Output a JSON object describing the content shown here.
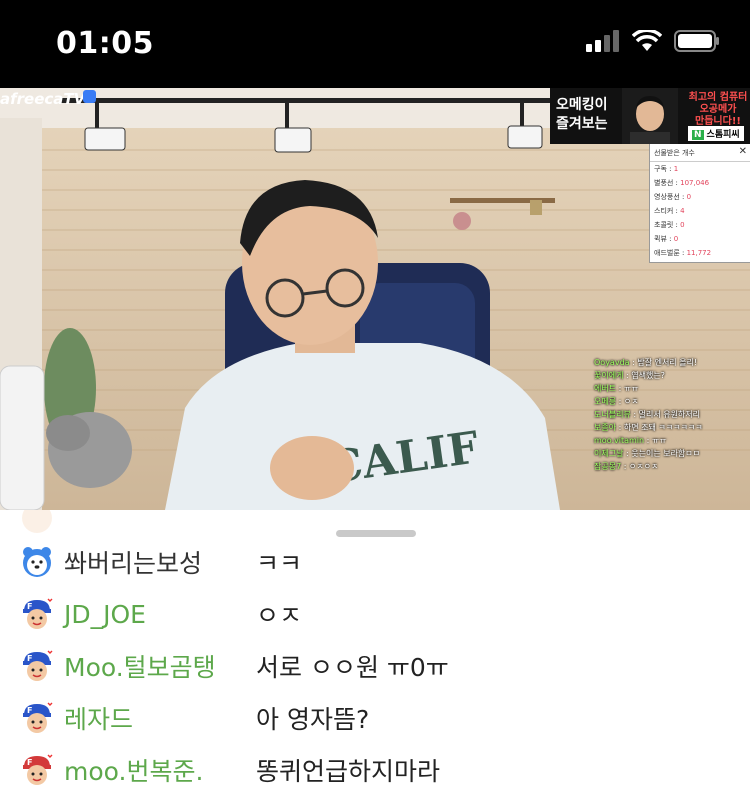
{
  "status": {
    "time": "01:05"
  },
  "video": {
    "brand": "afreecaTV",
    "ad": {
      "left_line1": "오메킹이",
      "left_line2": "즐겨보는",
      "right_line1": "최고의 컴퓨터",
      "right_line2": "오공메가",
      "right_line3": "만듭니다!!",
      "chip": "스톰피씨"
    },
    "gift_panel": {
      "title": "선물받은 개수",
      "rows": [
        {
          "label": "구독",
          "value": "1"
        },
        {
          "label": "별풍선",
          "value": "107,046"
        },
        {
          "label": "영상풍선",
          "value": "0"
        },
        {
          "label": "스티커",
          "value": "4"
        },
        {
          "label": "초콜릿",
          "value": "0"
        },
        {
          "label": "퀵뷰",
          "value": "0"
        },
        {
          "label": "애드벌룬",
          "value": "11,772"
        }
      ]
    },
    "overlay_chat": [
      {
        "nick": "Ooyavda",
        "msg": "밤잘 엔서리 올리!"
      },
      {
        "nick": "꽃이에게",
        "msg": "염색했는?"
      },
      {
        "nick": "에버트",
        "msg": "ㅠㅠ"
      },
      {
        "nick": "오메릉",
        "msg": "ㅇㅈ"
      },
      {
        "nick": "도너블리뷰",
        "msg": "멀리서 유원하저리"
      },
      {
        "nick": "보좀아",
        "msg": "하면 조돼 ㅋㅋㅋㅋㅋㅋ"
      },
      {
        "nick": "moo.vitamin",
        "msg": "ㅠㅠ"
      },
      {
        "nick": "이제그날",
        "msg": "웃는이는 보라함ㅁㅁ"
      },
      {
        "nick": "잠공몽7",
        "msg": "ㅇㅈㅇㅈ"
      }
    ]
  },
  "chat": {
    "messages": [
      {
        "nick": "쏴버리는보성",
        "msg": "ㅋㅋ",
        "color": "#333333",
        "avatar": "bear"
      },
      {
        "nick": "JD_JOE",
        "msg": "ㅇㅈ",
        "color": "#5da84b",
        "avatar": "fan"
      },
      {
        "nick": "Moo.털보곰탱",
        "msg": "서로 ㅇㅇ원 ㅠ0ㅠ",
        "color": "#5da84b",
        "avatar": "fan"
      },
      {
        "nick": "레자드",
        "msg": "아 영자뜸?",
        "color": "#5da84b",
        "avatar": "fan"
      },
      {
        "nick": "moo.번복준.",
        "msg": "똥퀴언급하지마라",
        "color": "#5da84b",
        "avatar": "fan-red"
      }
    ]
  }
}
